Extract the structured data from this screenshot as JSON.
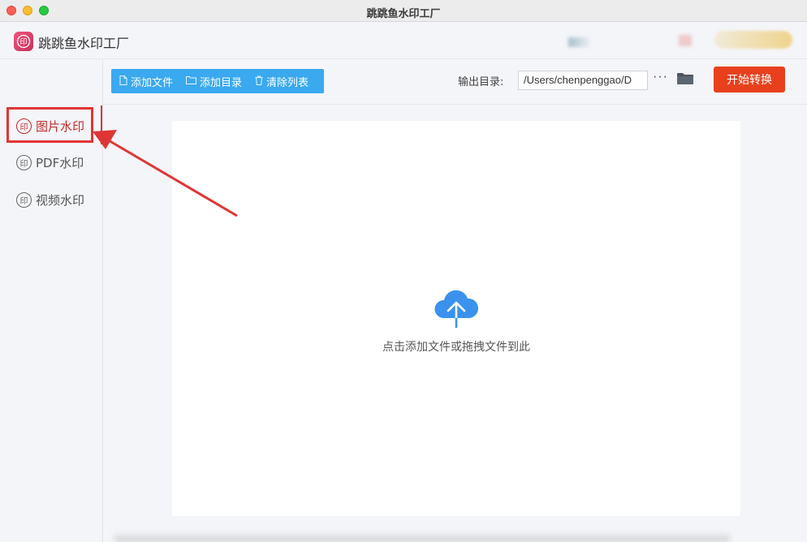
{
  "window": {
    "title": "跳跳鱼水印工厂"
  },
  "header": {
    "app_name": "跳跳鱼水印工厂",
    "logo_glyph": "印"
  },
  "sidebar": {
    "items": [
      {
        "label": "图片水印",
        "icon": "印",
        "active": true
      },
      {
        "label": "PDF水印",
        "icon": "印",
        "active": false
      },
      {
        "label": "视频水印",
        "icon": "印",
        "active": false
      }
    ]
  },
  "toolbar": {
    "add_file_label": "添加文件",
    "add_dir_label": "添加目录",
    "clear_list_label": "清除列表",
    "output_label": "输出目录:",
    "output_path": "/Users/chenpenggao/D",
    "more_label": "···",
    "start_label": "开始转换"
  },
  "main": {
    "drop_hint": "点击添加文件或拖拽文件到此"
  },
  "colors": {
    "accent_blue": "#3aa9f0",
    "start_red": "#e8401c",
    "highlight_red": "#e03535",
    "active_text": "#c62828",
    "cloud_blue": "#3a92ec"
  }
}
